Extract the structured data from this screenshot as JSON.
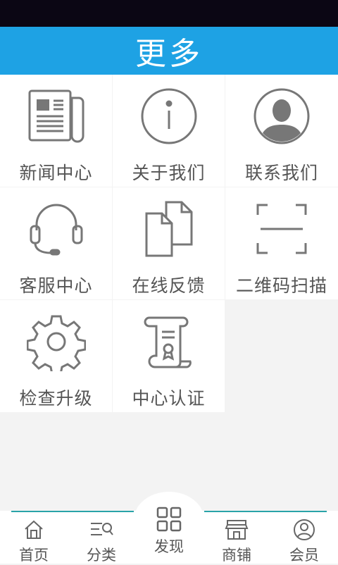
{
  "header": {
    "title": "更多"
  },
  "grid_items": [
    {
      "label": "新闻中心",
      "icon": "newspaper-icon"
    },
    {
      "label": "关于我们",
      "icon": "info-icon"
    },
    {
      "label": "联系我们",
      "icon": "contact-avatar-icon"
    },
    {
      "label": "客服中心",
      "icon": "headset-icon"
    },
    {
      "label": "在线反馈",
      "icon": "documents-icon"
    },
    {
      "label": "二维码扫描",
      "icon": "scan-frame-icon"
    },
    {
      "label": "检查升级",
      "icon": "gear-icon"
    },
    {
      "label": "中心认证",
      "icon": "certificate-scroll-icon"
    }
  ],
  "bottom_nav": [
    {
      "label": "首页",
      "icon": "home-icon"
    },
    {
      "label": "分类",
      "icon": "category-icon"
    },
    {
      "label": "发现",
      "icon": "grid-icon"
    },
    {
      "label": "商铺",
      "icon": "shop-icon"
    },
    {
      "label": "会员",
      "icon": "user-icon"
    }
  ],
  "colors": {
    "header_bg": "#1ea2e4",
    "status_bar": "#0b0614",
    "icon_stroke": "#777777",
    "nav_accent": "#29a3a8"
  }
}
